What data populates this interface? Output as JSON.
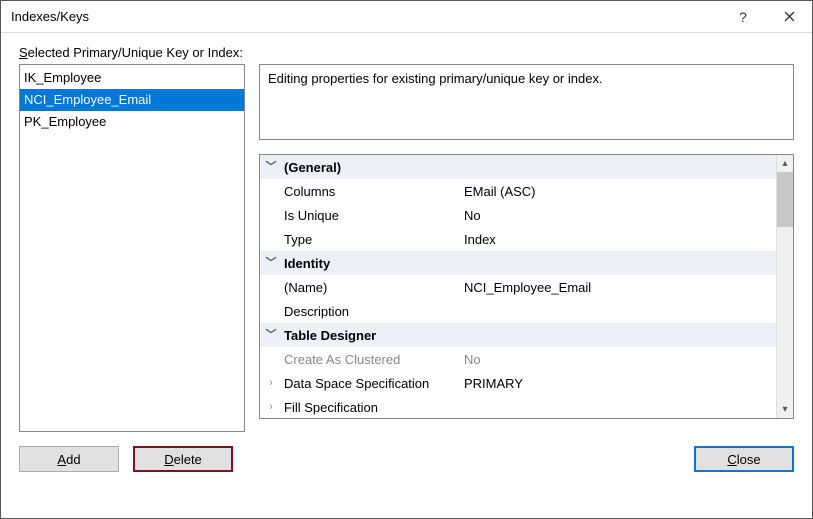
{
  "window": {
    "title": "Indexes/Keys"
  },
  "section_label": "Selected Primary/Unique Key or Index:",
  "list": {
    "items": [
      "IK_Employee",
      "NCI_Employee_Email",
      "PK_Employee"
    ],
    "selected_index": 1
  },
  "description": "Editing properties for existing primary/unique key or index.",
  "categories": {
    "general": {
      "title": "(General)",
      "columns_label": "Columns",
      "columns_value": "EMail (ASC)",
      "is_unique_label": "Is Unique",
      "is_unique_value": "No",
      "type_label": "Type",
      "type_value": "Index"
    },
    "identity": {
      "title": "Identity",
      "name_label": "(Name)",
      "name_value": "NCI_Employee_Email",
      "description_label": "Description",
      "description_value": ""
    },
    "table_designer": {
      "title": "Table Designer",
      "create_clustered_label": "Create As Clustered",
      "create_clustered_value": "No",
      "data_space_label": "Data Space Specification",
      "data_space_value": "PRIMARY",
      "fill_spec_label": "Fill Specification",
      "fill_spec_value": ""
    }
  },
  "buttons": {
    "add": "Add",
    "delete": "Delete",
    "close": "Close"
  }
}
